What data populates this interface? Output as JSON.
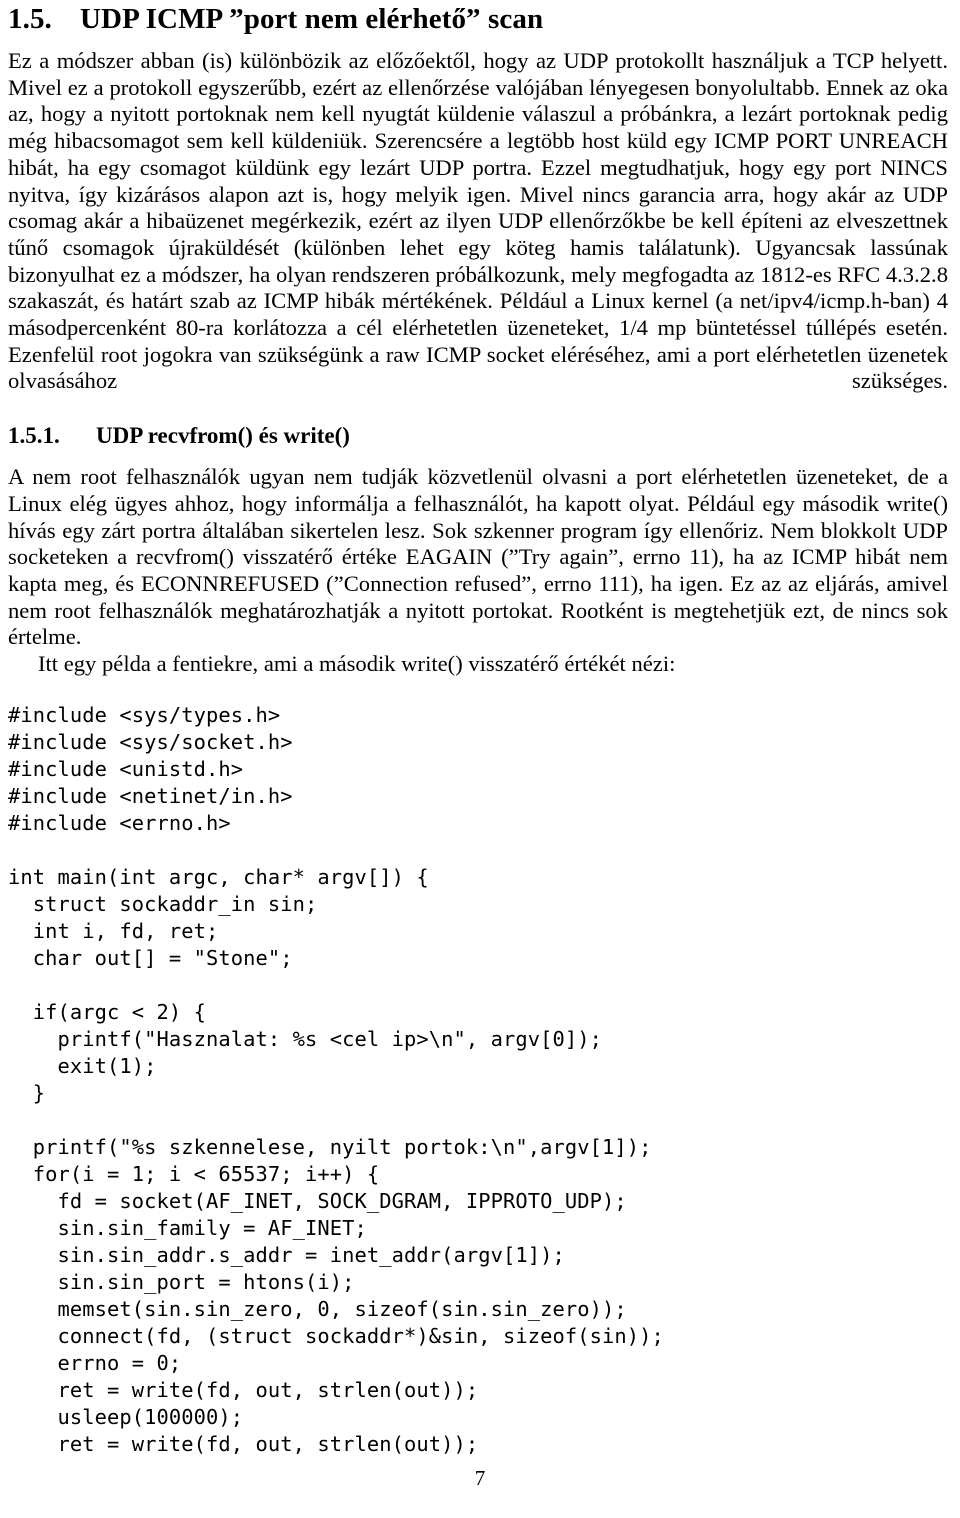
{
  "document": {
    "language": "hu",
    "page_number": "7"
  },
  "section": {
    "number": "1.5.",
    "title": "UDP ICMP ”port nem elérhető” scan"
  },
  "paragraphs": {
    "intro": "Ez a módszer abban (is) különbözik az előzőektől, hogy az UDP protokollt használjuk a TCP helyett. Mivel ez a protokoll egyszerűbb, ezért az ellenőrzése valójában lényegesen bonyolultabb. Ennek az oka az, hogy a nyitott portoknak nem kell nyugtát küldenie válaszul a próbánkra, a lezárt portoknak pedig még hibacsomagot sem kell küldeniük. Szerencsére a legtöbb host küld egy ICMP PORT UNREACH hibát, ha egy csomagot küldünk egy lezárt UDP portra. Ezzel megtudhatjuk, hogy egy port NINCS nyitva, így kizárásos alapon azt is, hogy melyik igen. Mivel nincs garancia arra, hogy akár az UDP csomag akár a hibaüzenet megérkezik, ezért az ilyen UDP ellenőrzőkbe be kell építeni az elveszettnek tűnő csomagok újraküldését (különben lehet egy köteg hamis találatunk). Ugyancsak lassúnak bizonyulhat ez a módszer, ha olyan rendszeren próbálkozunk, mely megfogadta az 1812-es RFC 4.3.2.8 szakaszát, és határt szab az ICMP hibák mértékének. Például a Linux kernel (a net/ipv4/icmp.h-ban) 4 másodpercenként 80-ra korlátozza a cél elérhetetlen üzeneteket, 1/4 mp büntetéssel túllépés esetén. Ezenfelül root jogokra van szükségünk a raw ICMP socket eléréséhez, ami a port elérhetetlen üzenetek olvasásához szükséges."
  },
  "subsection": {
    "number": "1.5.1.",
    "title": "UDP recvfrom() és write()",
    "paragraph": "A nem root felhasználók ugyan nem tudják közvetlenül olvasni a port elérhetetlen üzeneteket, de a Linux elég ügyes ahhoz, hogy informálja a felhasználót, ha kapott olyat. Például egy második write() hívás egy zárt portra általában sikertelen lesz. Sok szkenner program így ellenőriz. Nem blokkolt UDP socketeken a recvfrom() visszatérő értéke EAGAIN (”Try again”, errno 11), ha az ICMP hibát nem kapta meg, és ECONNREFUSED (”Connection refused”, errno 111), ha igen. Ez az az eljárás, amivel nem root felhasználók meghatározhatják a nyitott portokat. Rootként is megtehetjük ezt, de nincs sok értelme.",
    "example_intro": "Itt egy példa a fentiekre, ami a második write() visszatérő értékét nézi:"
  },
  "code": {
    "language": "c",
    "includes": "#include <sys/types.h>\n#include <sys/socket.h>\n#include <unistd.h>\n#include <netinet/in.h>\n#include <errno.h>",
    "main_decls": "int main(int argc, char* argv[]) {\n  struct sockaddr_in sin;\n  int i, fd, ret;\n  char out[] = \"Stone\";",
    "argc_check": "  if(argc < 2) {\n    printf(\"Hasznalat: %s <cel ip>\\n\", argv[0]);\n    exit(1);\n  }",
    "scan_loop": "  printf(\"%s szkennelese, nyilt portok:\\n\",argv[1]);\n  for(i = 1; i < 65537; i++) {\n    fd = socket(AF_INET, SOCK_DGRAM, IPPROTO_UDP);\n    sin.sin_family = AF_INET;\n    sin.sin_addr.s_addr = inet_addr(argv[1]);\n    sin.sin_port = htons(i);\n    memset(sin.sin_zero, 0, sizeof(sin.sin_zero));\n    connect(fd, (struct sockaddr*)&sin, sizeof(sin));\n    errno = 0;\n    ret = write(fd, out, strlen(out));\n    usleep(100000);\n    ret = write(fd, out, strlen(out));"
  }
}
